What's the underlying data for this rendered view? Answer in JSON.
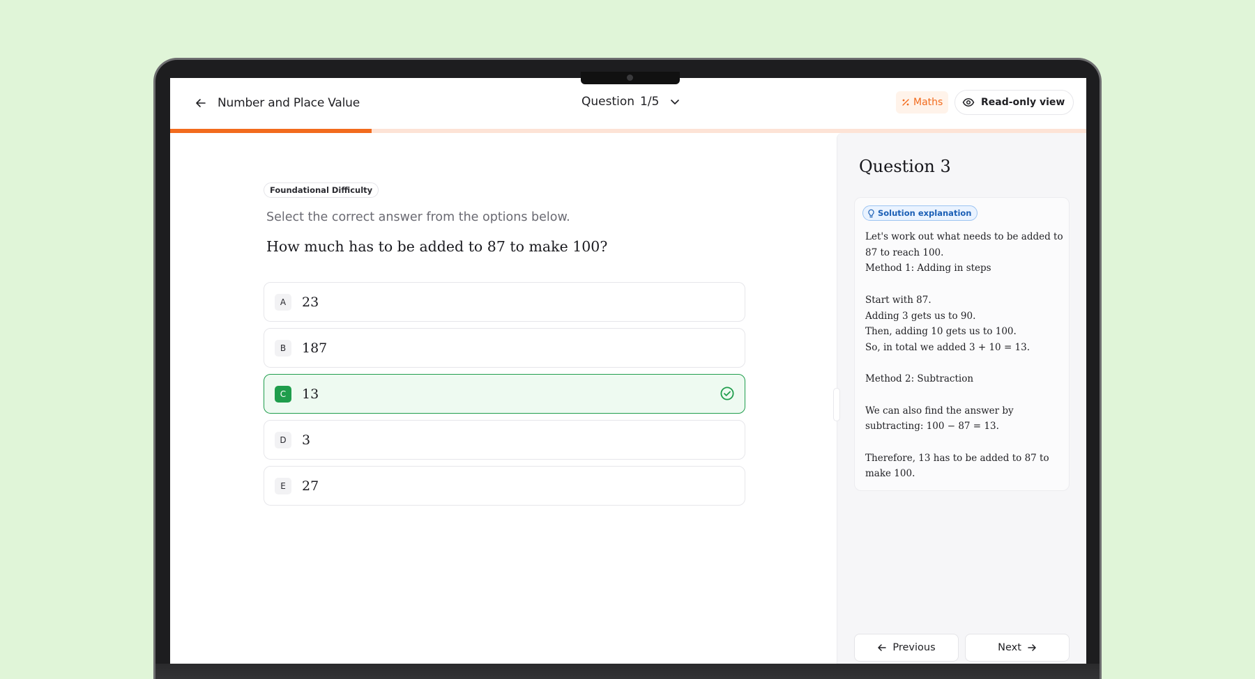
{
  "header": {
    "topic_title": "Number and Place Value",
    "question_label": "Question",
    "question_counter": "1/5",
    "subject_badge": "Maths",
    "readonly_label": "Read-only view"
  },
  "progress": {
    "fraction": 0.22
  },
  "main": {
    "difficulty": "Foundational Difficulty",
    "instruction": "Select the correct answer from the options below.",
    "question": "How much has to be added to 87 to make 100?",
    "options": [
      {
        "letter": "A",
        "value": "23",
        "correct": false
      },
      {
        "letter": "B",
        "value": "187",
        "correct": false
      },
      {
        "letter": "C",
        "value": "13",
        "correct": true
      },
      {
        "letter": "D",
        "value": "3",
        "correct": false
      },
      {
        "letter": "E",
        "value": "27",
        "correct": false
      }
    ]
  },
  "side": {
    "title": "Question 3",
    "solution_chip": "Solution explanation",
    "solution_lines": [
      "Let's work out what needs to be added to 87 to reach 100.",
      "Method 1: Adding in steps",
      "",
      "Start with 87.",
      "Adding 3 gets us to 90.",
      "Then, adding 10 gets us to 100.",
      "So, in total we added 3 + 10 = 13.",
      "",
      "Method 2: Subtraction",
      "",
      "We can also find the answer by subtracting: 100 − 87 = 13.",
      "",
      "Therefore, 13 has to be added to 87 to make 100."
    ],
    "prev_label": "Previous",
    "next_label": "Next"
  },
  "colors": {
    "accent": "#f26b1d",
    "correct": "#1f9d4c",
    "background": "#e0f5d8"
  }
}
